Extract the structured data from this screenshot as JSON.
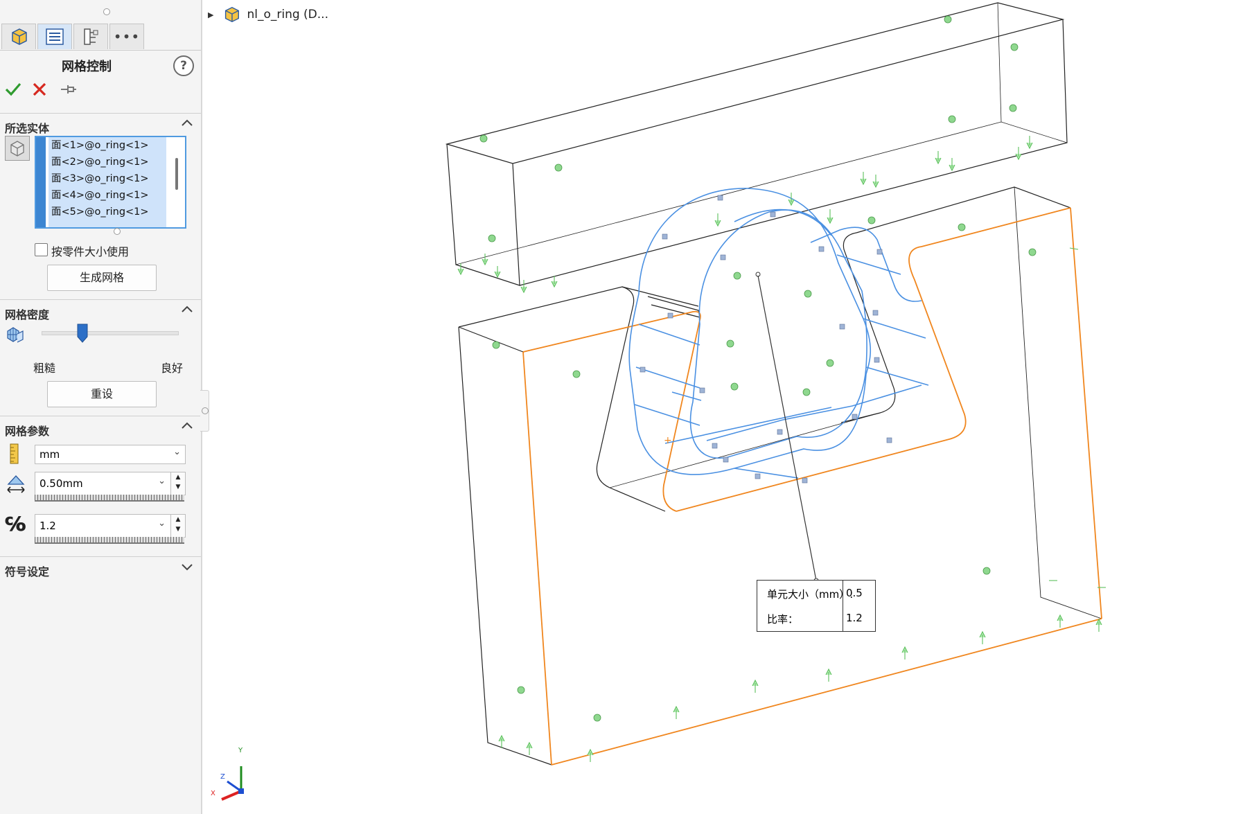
{
  "feature_manager": {
    "tabs": [
      "feature-manager",
      "property-manager",
      "configuration-manager",
      "more"
    ],
    "title": "网格控制",
    "help_label": "?",
    "ok_icon": "checkmark-icon",
    "cancel_icon": "close-icon",
    "pin_icon": "pushpin-icon"
  },
  "selected_entities": {
    "header": "所选实体",
    "items": [
      "面<1>@o_ring<1>",
      "面<2>@o_ring<1>",
      "面<3>@o_ring<1>",
      "面<4>@o_ring<1>",
      "面<5>@o_ring<1>"
    ],
    "use_part_size_label": "按零件大小使用",
    "use_part_size_checked": false,
    "generate_button": "生成网格"
  },
  "mesh_density": {
    "header": "网格密度",
    "coarse_label": "粗糙",
    "fine_label": "良好",
    "slider_value": 0.3,
    "reset_button": "重设"
  },
  "mesh_params": {
    "header": "网格参数",
    "unit": "mm",
    "element_size": "0.50mm",
    "ratio": "1.2"
  },
  "symbol_settings": {
    "header": "符号设定"
  },
  "tree": {
    "label": "nl_o_ring (D..."
  },
  "mesh_callout": {
    "size_label": "单元大小（mm）:",
    "size_value": "0.5",
    "ratio_label": "比率：",
    "ratio_value": "1.2"
  },
  "triad": {
    "x": "X",
    "y": "Y",
    "z": "Z"
  },
  "colors": {
    "accent_blue": "#3d86d2",
    "selected_face_blue": "#4a90e2",
    "edge_orange": "#f0861e",
    "marker_green": "#5bbf5b"
  }
}
